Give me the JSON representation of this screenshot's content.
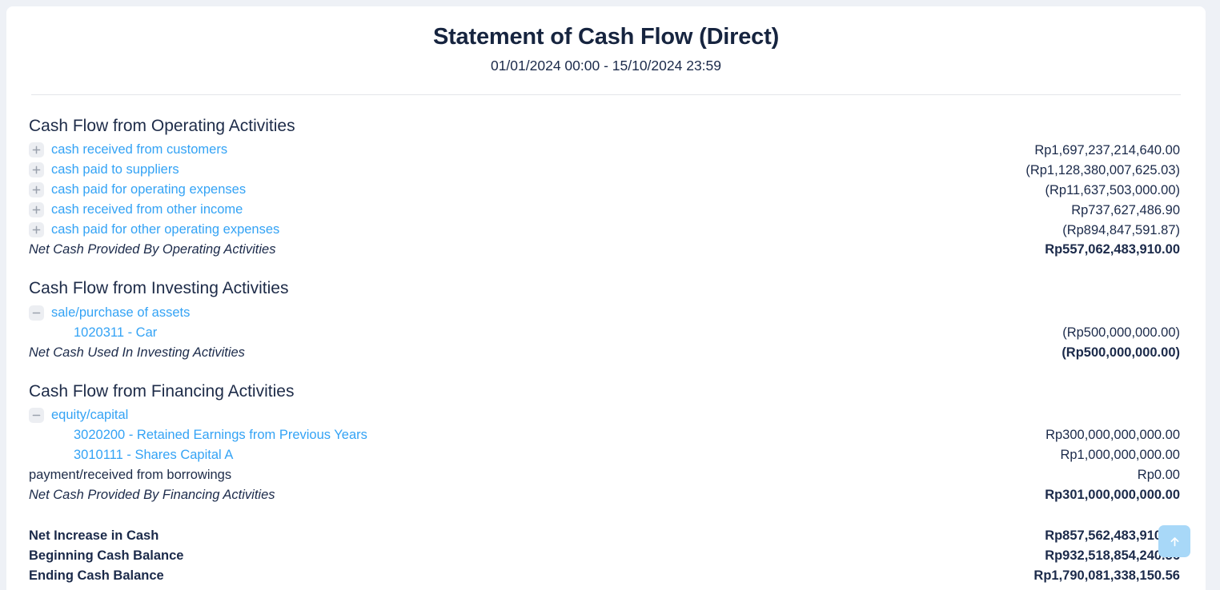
{
  "header": {
    "title": "Statement of Cash Flow (Direct)",
    "period": "01/01/2024 00:00 - 15/10/2024 23:59"
  },
  "colors": {
    "link": "#34a3f5",
    "text": "#1b2a4a",
    "page_background": "#eef1f6",
    "card_background": "#ffffff",
    "icon_background": "#eceef2",
    "scroll_button": "#a8d8f8"
  },
  "sections": [
    {
      "heading": "Cash Flow from Operating Activities",
      "rows": [
        {
          "icon": "plus-icon",
          "label": "cash received from customers",
          "amount": "Rp1,697,237,214,640.00"
        },
        {
          "icon": "plus-icon",
          "label": "cash paid to suppliers",
          "amount": "(Rp1,128,380,007,625.03)"
        },
        {
          "icon": "plus-icon",
          "label": "cash paid for operating expenses",
          "amount": "(Rp11,637,503,000.00)"
        },
        {
          "icon": "plus-icon",
          "label": "cash received from other income",
          "amount": "Rp737,627,486.90"
        },
        {
          "icon": "plus-icon",
          "label": "cash paid for other operating expenses",
          "amount": "(Rp894,847,591.87)"
        }
      ],
      "subtotal": {
        "label": "Net Cash Provided By Operating Activities",
        "amount": "Rp557,062,483,910.00"
      }
    },
    {
      "heading": "Cash Flow from Investing Activities",
      "rows": [
        {
          "icon": "minus-icon",
          "label": "sale/purchase of assets",
          "amount": ""
        },
        {
          "icon": "none",
          "child": true,
          "label": "1020311 - Car",
          "amount": "(Rp500,000,000.00)"
        }
      ],
      "subtotal": {
        "label": "Net Cash Used In Investing Activities",
        "amount": "(Rp500,000,000.00)"
      }
    },
    {
      "heading": "Cash Flow from Financing Activities",
      "rows": [
        {
          "icon": "minus-icon",
          "label": "equity/capital",
          "amount": ""
        },
        {
          "icon": "none",
          "child": true,
          "label": "3020200 - Retained Earnings from Previous Years",
          "amount": "Rp300,000,000,000.00"
        },
        {
          "icon": "none",
          "child": true,
          "label": "3010111 - Shares Capital A",
          "amount": "Rp1,000,000,000.00"
        },
        {
          "icon": "none",
          "plain": true,
          "label": "payment/received from borrowings",
          "amount": "Rp0.00"
        }
      ],
      "subtotal": {
        "label": "Net Cash Provided By Financing Activities",
        "amount": "Rp301,000,000,000.00"
      }
    }
  ],
  "summary": [
    {
      "label": "Net Increase in Cash",
      "amount": "Rp857,562,483,910.00"
    },
    {
      "label": "Beginning Cash Balance",
      "amount": "Rp932,518,854,240.56"
    },
    {
      "label": "Ending Cash Balance",
      "amount": "Rp1,790,081,338,150.56"
    }
  ],
  "scroll_top_button": {
    "icon": "arrow-up-icon"
  }
}
